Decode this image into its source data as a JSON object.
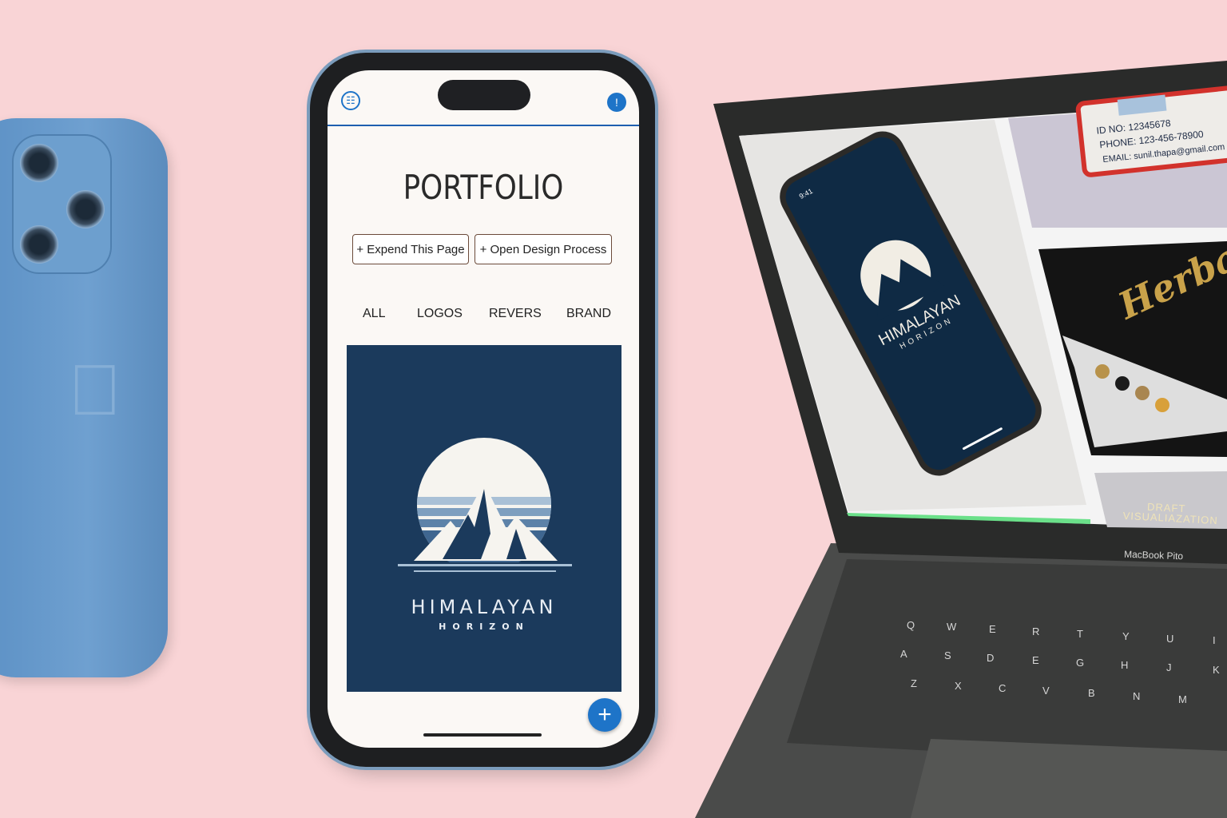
{
  "phone": {
    "title": "PORTFOLIO",
    "buttons": [
      "+ Expend This Page",
      "+ Open Design Process"
    ],
    "tabs": [
      "ALL",
      "LOGOS",
      "REVERS",
      "BRAND"
    ],
    "logo": {
      "name": "HIMALAYAN",
      "tagline": "HORIZON"
    },
    "fab": "+",
    "icons": {
      "left": "globe-icon",
      "right": "info-icon",
      "fab": "plus-icon"
    },
    "accent": "#1e74c8"
  },
  "laptop": {
    "brand": "MacBook Pito",
    "screen": {
      "phone_mock": {
        "time": "9:41",
        "logo_name": "HIMALAYAN",
        "logo_tagline": "HORIZON"
      },
      "id_card": {
        "id": "ID NO:  12345678",
        "phone": "PHONE: 123-456-78900",
        "email": "EMAIL:  sunil.thapa@gmail.com"
      },
      "business_card": {
        "script": "Herbal Sanep"
      },
      "draft": [
        "DRAFT",
        "VISUALIAZATION"
      ]
    },
    "keyboard": {
      "rows": [
        [
          "Q",
          "W",
          "E",
          "R",
          "T",
          "Y",
          "U",
          "I"
        ],
        [
          "A",
          "S",
          "D",
          "E",
          "G",
          "H",
          "J",
          "K"
        ],
        [
          "Z",
          "X",
          "C",
          "V",
          "B",
          "N",
          "M"
        ]
      ]
    }
  },
  "colors": {
    "background": "#f9d4d6",
    "logo_bg": "#1b3a5c",
    "iphone_back": "#6fa0d0"
  }
}
